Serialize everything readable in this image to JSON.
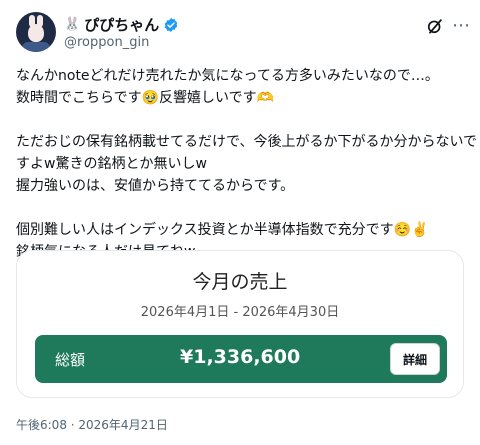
{
  "post": {
    "author": {
      "name_emoji": "🐰",
      "display_name": "ぴぴちゃん",
      "handle": "@roppon_gin",
      "verified": true
    },
    "text_lines": [
      "なんかnoteどれだけ売れたか気になってる方多いみたいなので…。",
      "数時間でこちらです🥹反響嬉しいです🫶",
      "",
      "ただおじの保有銘柄載せてるだけで、今後上がるか下がるか分からないで",
      "すよw驚きの銘柄とか無いしw",
      "握力強いのは、安値から持ててるからです。",
      "",
      "個別難しい人はインデックス投資とか半導体指数で充分です☺️✌️",
      "銘柄気になる人だけ見てねw"
    ],
    "timestamp": "午後6:08 · 2026年4月21日"
  },
  "sales_card": {
    "title": "今月の売上",
    "date_range": "2026年4月1日 - 2026年4月30日",
    "total_label": "総額",
    "total_amount": "¥1,336,600",
    "detail_button": "詳細"
  },
  "icons": {
    "grok": "grok-icon",
    "more": "more-icon",
    "verified": "verified-badge-icon"
  },
  "colors": {
    "accent_green": "#1e7a5a",
    "verified_blue": "#1d9bf0",
    "text_secondary": "#536471"
  }
}
